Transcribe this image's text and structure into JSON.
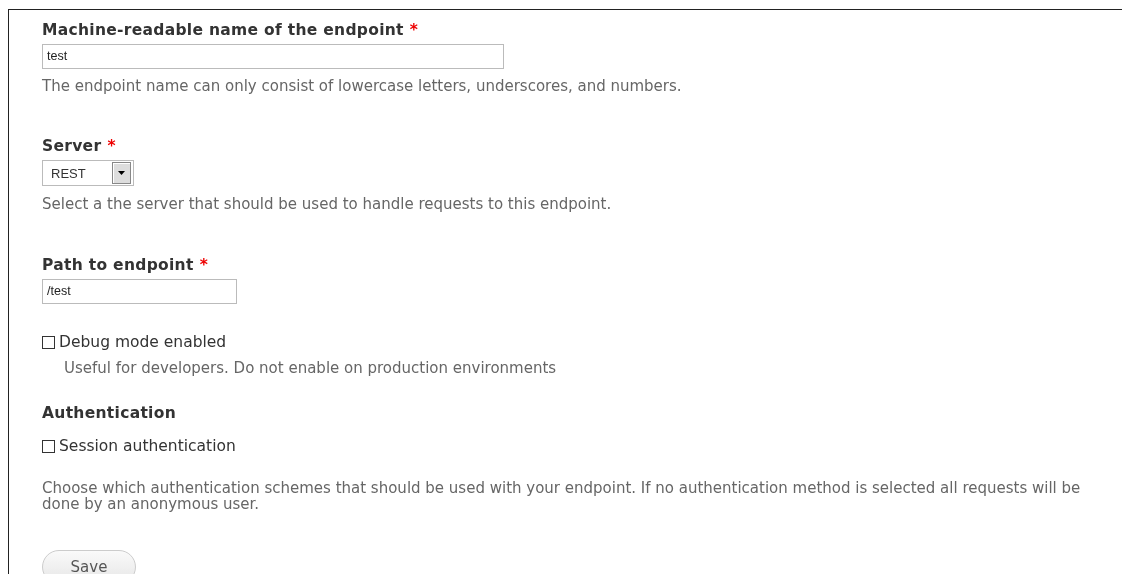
{
  "fields": [
    {
      "kind": "text",
      "label": "Machine-readable name of the endpoint",
      "required": true,
      "value": "test",
      "description": "The endpoint name can only consist of lowercase letters, underscores, and numbers.",
      "wide": true
    },
    {
      "kind": "select",
      "label": "Server",
      "required": true,
      "value": "REST",
      "description": "Select a the server that should be used to handle requests to this endpoint."
    },
    {
      "kind": "text",
      "label": "Path to endpoint",
      "required": true,
      "value": "/test",
      "wide": false
    },
    {
      "kind": "checkbox",
      "label": "Debug mode enabled",
      "checked": false,
      "description": "Useful for developers. Do not enable on production environments"
    },
    {
      "kind": "heading",
      "label": "Authentication"
    },
    {
      "kind": "checkbox",
      "label": "Session authentication",
      "checked": false
    },
    {
      "kind": "note",
      "description": "Choose which authentication schemes that should be used with your endpoint. If no authentication method is selected all requests will be done by an anonymous user."
    }
  ],
  "required_mark": "*",
  "save_button": "Save"
}
